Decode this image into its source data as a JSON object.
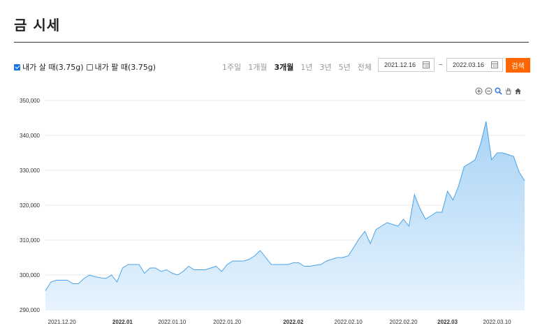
{
  "header": {
    "title": "금 시세"
  },
  "controls": {
    "buy_label": "내가 살 때(3.75g)",
    "sell_label": "내가 팔 때(3.75g)",
    "buy_checked": true,
    "sell_checked": false,
    "periods": [
      "1주일",
      "1개월",
      "3개월",
      "1년",
      "3년",
      "5년",
      "전체"
    ],
    "active_period": "3개월",
    "start_date": "2021.12.16",
    "end_date": "2022.03.16",
    "tilde": "~",
    "search_label": "검색"
  },
  "toolbar": {
    "icons": [
      "zoom-in-icon",
      "zoom-out-icon",
      "magnify-icon",
      "hand-pan-icon",
      "home-icon"
    ]
  },
  "colors": {
    "accent": "#ff6600",
    "line": "#4aa3e8",
    "fill_top": "#a9d3f5",
    "fill_bottom": "#e6f3fd"
  },
  "chart_data": {
    "type": "area",
    "title": "",
    "xlabel": "",
    "ylabel": "",
    "ylim": [
      290000,
      350000
    ],
    "yticks": [
      "290,000",
      "300,000",
      "310,000",
      "320,000",
      "330,000",
      "340,000",
      "350,000"
    ],
    "ytick_values": [
      290000,
      300000,
      310000,
      320000,
      330000,
      340000,
      350000
    ],
    "xticks": [
      {
        "label": "2021.12.20",
        "index": 3,
        "bold": false
      },
      {
        "label": "2022.01",
        "index": 14,
        "bold": true
      },
      {
        "label": "2022.01.10",
        "index": 23,
        "bold": false
      },
      {
        "label": "2022.01.20",
        "index": 33,
        "bold": false
      },
      {
        "label": "2022.02",
        "index": 45,
        "bold": true
      },
      {
        "label": "2022.02.10",
        "index": 55,
        "bold": false
      },
      {
        "label": "2022.02.20",
        "index": 65,
        "bold": false
      },
      {
        "label": "2022.03",
        "index": 73,
        "bold": true
      },
      {
        "label": "2022.03.10",
        "index": 82,
        "bold": false
      }
    ],
    "grid": true,
    "series": [
      {
        "values": [
          295500,
          298000,
          298500,
          298500,
          298500,
          297500,
          297500,
          299000,
          300000,
          299500,
          299200,
          299000,
          300000,
          298000,
          302000,
          303000,
          303000,
          303000,
          300500,
          302000,
          302000,
          301000,
          301500,
          300500,
          300000,
          301000,
          302500,
          301500,
          301500,
          301500,
          302000,
          302500,
          301000,
          303000,
          304000,
          304000,
          304000,
          304500,
          305500,
          307000,
          305000,
          303000,
          303000,
          303000,
          303000,
          303500,
          303500,
          302500,
          302500,
          302800,
          303000,
          304000,
          304500,
          305000,
          305000,
          305500,
          308000,
          310500,
          312500,
          309000,
          313000,
          314000,
          315000,
          314500,
          314000,
          316000,
          314000,
          323000,
          319000,
          316000,
          317000,
          318000,
          318000,
          324000,
          321500,
          325500,
          331000,
          332000,
          333000,
          337500,
          344000,
          333000,
          335000,
          335000,
          334500,
          334000,
          329500,
          327000
        ]
      }
    ]
  }
}
